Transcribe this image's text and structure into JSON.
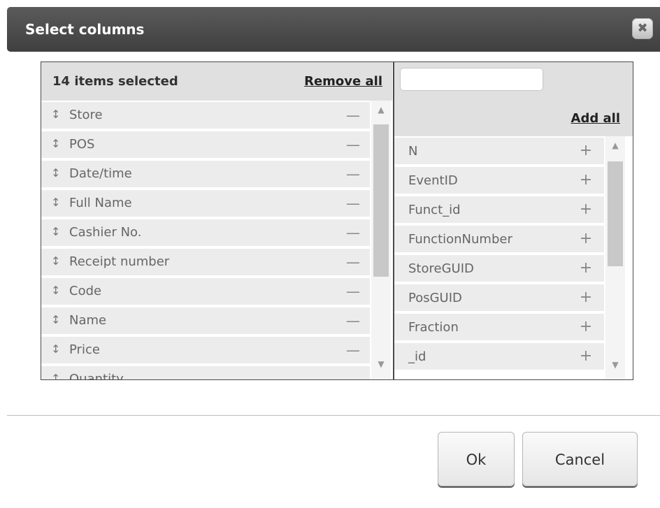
{
  "dialog": {
    "title": "Select columns",
    "close_icon": "close-icon",
    "close_glyph": "✖"
  },
  "selected": {
    "count_label": "14 items selected",
    "remove_all": "Remove all",
    "drag_glyph": "↕",
    "remove_glyph": "—",
    "items": [
      {
        "label": "Store"
      },
      {
        "label": "POS"
      },
      {
        "label": "Date/time"
      },
      {
        "label": "Full Name"
      },
      {
        "label": "Cashier No."
      },
      {
        "label": "Receipt number"
      },
      {
        "label": "Code"
      },
      {
        "label": "Name"
      },
      {
        "label": "Price"
      },
      {
        "label": "Quantity"
      }
    ]
  },
  "available": {
    "search_placeholder": "",
    "search_value": "",
    "add_all": "Add all",
    "add_glyph": "+",
    "items": [
      {
        "label": "N"
      },
      {
        "label": "EventID"
      },
      {
        "label": "Funct_id"
      },
      {
        "label": "FunctionNumber"
      },
      {
        "label": "StoreGUID"
      },
      {
        "label": "PosGUID"
      },
      {
        "label": "Fraction"
      },
      {
        "label": "_id"
      }
    ]
  },
  "scroll_glyphs": {
    "up": "▲",
    "down": "▼"
  },
  "footer": {
    "ok_label": "Ok",
    "cancel_label": "Cancel"
  }
}
